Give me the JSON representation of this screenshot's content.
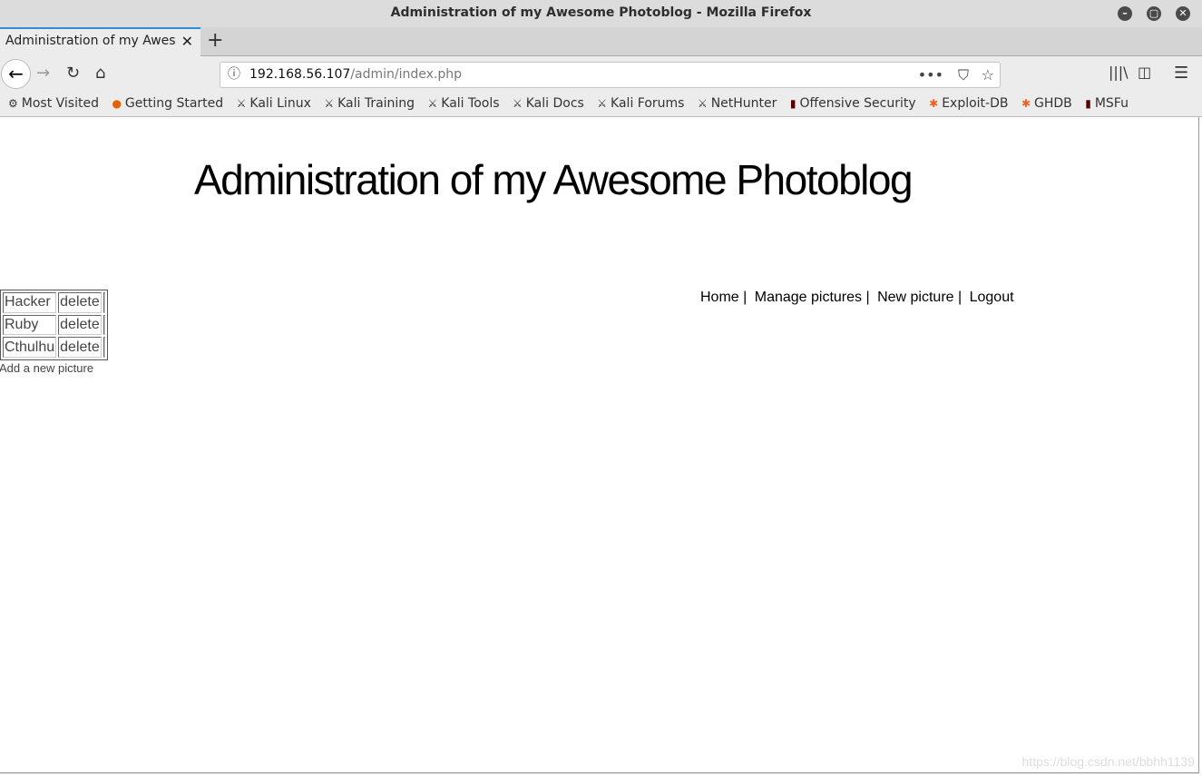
{
  "window": {
    "title": "Administration of my Awesome Photoblog - Mozilla Firefox"
  },
  "tab": {
    "label": "Administration of my Awesome Photoblog"
  },
  "url": {
    "host": "192.168.56.107",
    "path": "/admin/index.php"
  },
  "bookmarks": [
    {
      "label": "Most Visited",
      "icon": "gear-icon"
    },
    {
      "label": "Getting Started",
      "icon": "firefox-icon"
    },
    {
      "label": "Kali Linux",
      "icon": "kali-icon"
    },
    {
      "label": "Kali Training",
      "icon": "kali-icon"
    },
    {
      "label": "Kali Tools",
      "icon": "kali-icon"
    },
    {
      "label": "Kali Docs",
      "icon": "kali-icon"
    },
    {
      "label": "Kali Forums",
      "icon": "kali-icon"
    },
    {
      "label": "NetHunter",
      "icon": "kali-icon"
    },
    {
      "label": "Offensive Security",
      "icon": "offsec-icon"
    },
    {
      "label": "Exploit-DB",
      "icon": "exploitdb-icon"
    },
    {
      "label": "GHDB",
      "icon": "exploitdb-icon"
    },
    {
      "label": "MSFu",
      "icon": "offsec-icon"
    }
  ],
  "page": {
    "title": "Administration of my Awesome Photoblog",
    "menu": [
      "Home |",
      "Manage pictures |",
      "New picture |",
      "Logout"
    ],
    "pictures": [
      {
        "name": "Hacker",
        "action": "delete"
      },
      {
        "name": "Ruby",
        "action": "delete"
      },
      {
        "name": "Cthulhu",
        "action": "delete"
      }
    ],
    "add_link": "Add a new picture"
  },
  "watermark": "https://blog.csdn.net/bbhh1139"
}
